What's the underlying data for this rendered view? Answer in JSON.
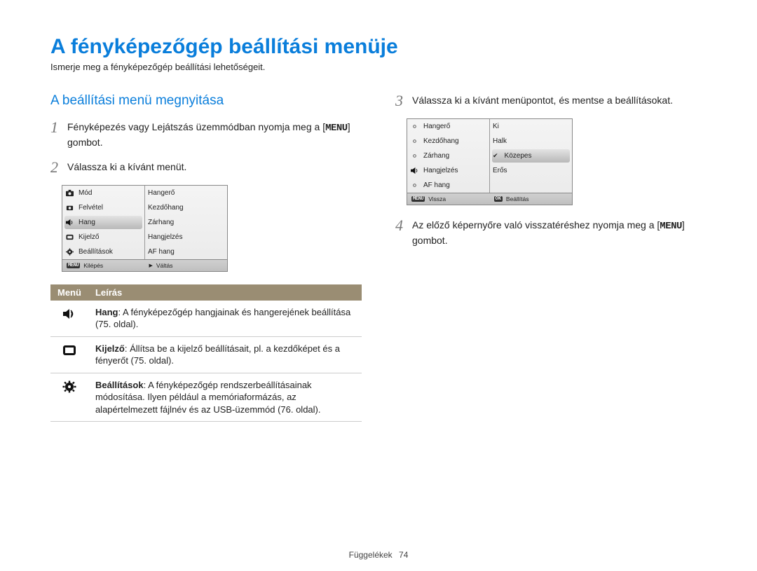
{
  "title": "A fényképezőgép beállítási menüje",
  "intro": "Ismerje meg a fényképezőgép beállítási lehetőségeit.",
  "subheading": "A beállítási menü megnyitása",
  "steps": {
    "s1a": "Fényképezés vagy Lejátszás üzemmódban nyomja meg a ",
    "s1b": " gombot.",
    "s2": "Válassza ki a kívánt menüt.",
    "s3": "Válassza ki a kívánt menüpontot, és mentse a beállításokat.",
    "s4a": "Az előző képernyőre való visszatéréshez nyomja meg a ",
    "s4b": " gombot."
  },
  "menu_word": "MENU",
  "cam1": {
    "left": [
      "Mód",
      "Felvétel",
      "Hang",
      "Kijelző",
      "Beállítások"
    ],
    "right": [
      "Hangerő",
      "Kezdőhang",
      "Zárhang",
      "Hangjelzés",
      "AF hang"
    ],
    "selected_left_index": 2,
    "foot_left_btn": "MENU",
    "foot_left_txt": "Kilépés",
    "foot_right_icon": "▶",
    "foot_right_txt": "Váltás"
  },
  "cam2": {
    "left": [
      "Hangerő",
      "Kezdőhang",
      "Zárhang",
      "Hangjelzés",
      "AF hang"
    ],
    "right": [
      "Ki",
      "Halk",
      "Közepes",
      "Erős"
    ],
    "selected_right_index": 2,
    "foot_left_btn": "MENU",
    "foot_left_txt": "Vissza",
    "foot_right_btn": "OK",
    "foot_right_txt": "Beállítás"
  },
  "table": {
    "head_menu": "Menü",
    "head_desc": "Leírás",
    "rows": [
      {
        "icon": "sound",
        "bold": "Hang",
        "rest": ": A fényképezőgép hangjainak és hangerejének beállítása (75. oldal)."
      },
      {
        "icon": "display",
        "bold": "Kijelző",
        "rest": ": Állítsa be a kijelző beállításait, pl. a kezdőképet és a fényerőt (75. oldal)."
      },
      {
        "icon": "gear",
        "bold": "Beállítások",
        "rest": ": A fényképezőgép rendszerbeállításainak módosítása. Ilyen például a memóriaformázás, az alapértelmezett fájlnév és az USB-üzemmód (76. oldal)."
      }
    ]
  },
  "footer": {
    "section": "Függelékek",
    "page": "74"
  }
}
